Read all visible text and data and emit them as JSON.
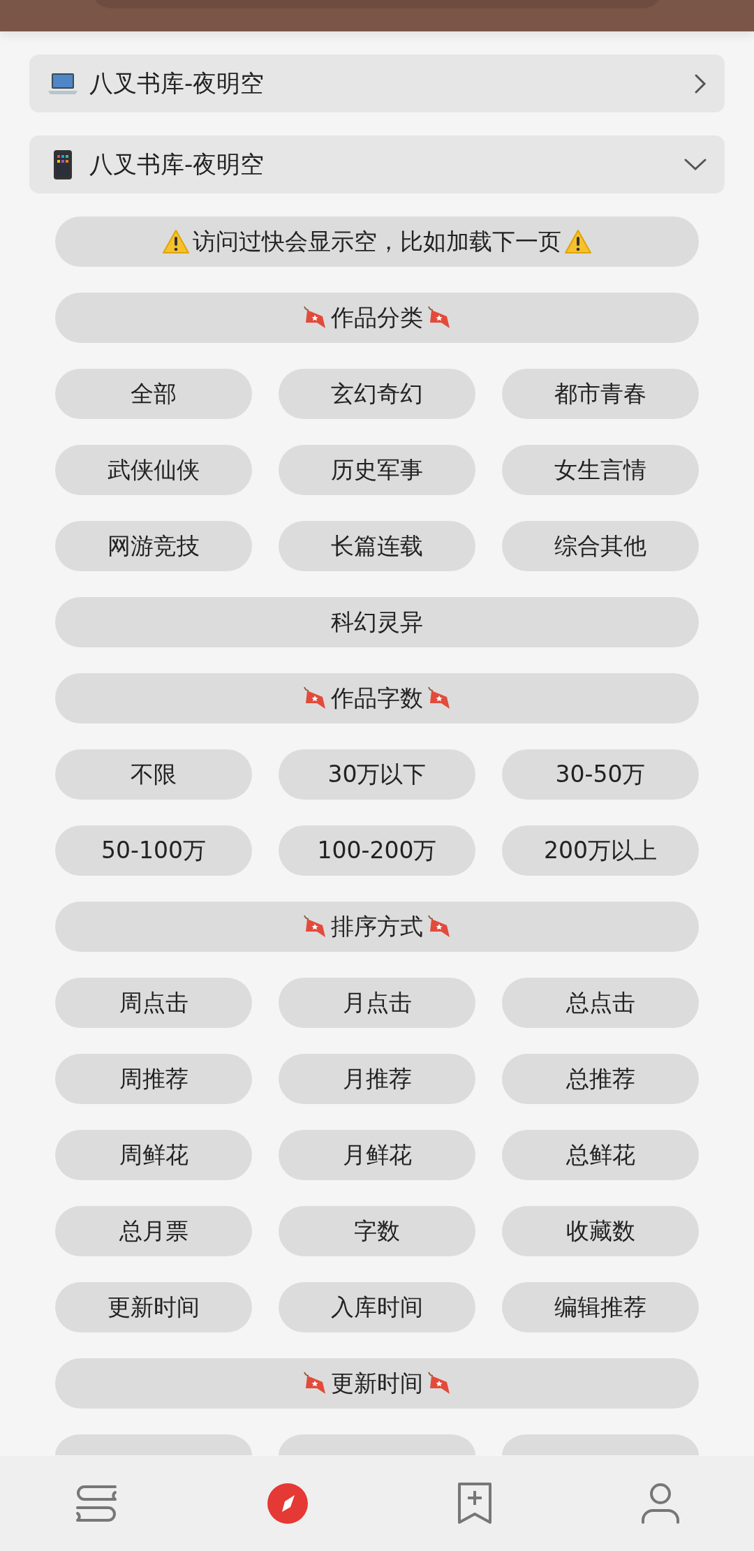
{
  "sources": [
    {
      "kind": "laptop",
      "title": "八叉书库-夜明空",
      "expanded": false
    },
    {
      "kind": "phone",
      "title": "八叉书库-夜明空",
      "expanded": true
    }
  ],
  "notice": "访问过快会显示空，比如加载下一页",
  "sections": [
    {
      "title": "作品分类",
      "options": [
        "全部",
        "玄幻奇幻",
        "都市青春",
        "武侠仙侠",
        "历史军事",
        "女生言情",
        "网游竞技",
        "长篇连载",
        "综合其他",
        "科幻灵异"
      ]
    },
    {
      "title": "作品字数",
      "options": [
        "不限",
        "30万以下",
        "30-50万",
        "50-100万",
        "100-200万",
        "200万以上"
      ]
    },
    {
      "title": "排序方式",
      "options": [
        "周点击",
        "月点击",
        "总点击",
        "周推荐",
        "月推荐",
        "总推荐",
        "周鲜花",
        "月鲜花",
        "总鲜花",
        "总月票",
        "字数",
        "收藏数",
        "更新时间",
        "入库时间",
        "编辑推荐"
      ]
    },
    {
      "title": "更新时间",
      "cut_options": [
        {
          "kind": "cut"
        },
        {
          "kind": "cut"
        },
        {
          "kind": "cut"
        }
      ]
    }
  ],
  "bottom_nav": [
    {
      "kind": "shelf",
      "selected": false
    },
    {
      "kind": "discover",
      "selected": true
    },
    {
      "kind": "bookmark",
      "selected": false
    },
    {
      "kind": "profile",
      "selected": false
    }
  ]
}
